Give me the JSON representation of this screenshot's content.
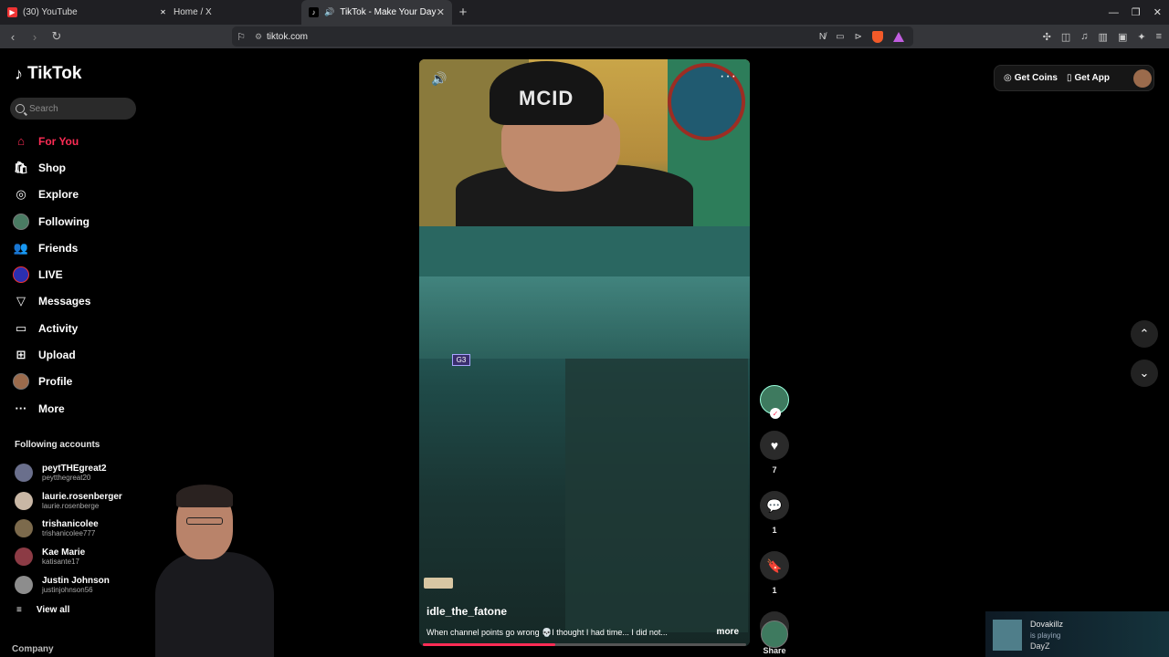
{
  "browser": {
    "tabs": [
      {
        "title": "(30) YouTube",
        "favicon": "youtube-icon"
      },
      {
        "title": "Home / X",
        "favicon": "x-icon"
      },
      {
        "title": "TikTok - Make Your Day",
        "favicon": "tiktok-icon",
        "active": true
      }
    ],
    "url": "tiktok.com"
  },
  "sidebar": {
    "logo": "TikTok",
    "search_placeholder": "Search",
    "menu": [
      {
        "label": "For You",
        "icon": "home-icon",
        "active": true
      },
      {
        "label": "Shop",
        "icon": "shop-icon"
      },
      {
        "label": "Explore",
        "icon": "compass-icon"
      },
      {
        "label": "Following",
        "icon": "avatar"
      },
      {
        "label": "Friends",
        "icon": "friends-icon"
      },
      {
        "label": "LIVE",
        "icon": "live-avatar"
      },
      {
        "label": "Messages",
        "icon": "send-icon"
      },
      {
        "label": "Activity",
        "icon": "activity-icon"
      },
      {
        "label": "Upload",
        "icon": "upload-icon"
      },
      {
        "label": "Profile",
        "icon": "profile-avatar"
      },
      {
        "label": "More",
        "icon": "more-icon"
      }
    ],
    "following_title": "Following accounts",
    "accounts": [
      {
        "name": "peytTHEgreat2",
        "username": "peytthegreat20"
      },
      {
        "name": "laurie.rosenberger",
        "username": "laurie.rosenberge"
      },
      {
        "name": "trishanicolee",
        "username": "trishanicolee777"
      },
      {
        "name": "Kae Marie",
        "username": "katisante17"
      },
      {
        "name": "Justin Johnson",
        "username": "justinjohnson56"
      }
    ],
    "view_all": "View all",
    "company": "Company"
  },
  "video": {
    "cap_text": "MCID",
    "hud_label": "G3",
    "author": "idle_the_fatone",
    "caption": "When channel points go wrong 💀I thought I had time... I did not...",
    "more": "more",
    "progress": 0.41
  },
  "actions": {
    "likes": "7",
    "comments": "1",
    "saves": "1",
    "share": "Share"
  },
  "topright": {
    "coins": "Get Coins",
    "app": "Get App"
  },
  "nowplaying": {
    "name": "Dovakillz",
    "status": "is playing",
    "game": "DayZ"
  },
  "colors": {
    "accent": "#fe2c55",
    "background": "#000000"
  }
}
